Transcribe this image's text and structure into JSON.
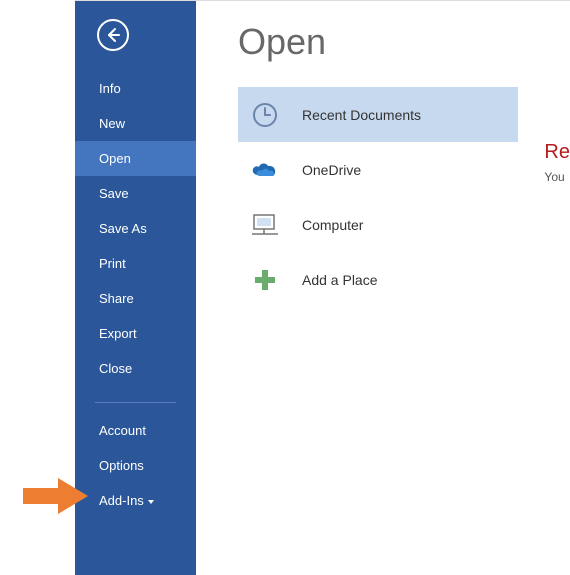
{
  "sidebar": {
    "items": [
      {
        "label": "Info"
      },
      {
        "label": "New"
      },
      {
        "label": "Open"
      },
      {
        "label": "Save"
      },
      {
        "label": "Save As"
      },
      {
        "label": "Print"
      },
      {
        "label": "Share"
      },
      {
        "label": "Export"
      },
      {
        "label": "Close"
      }
    ],
    "footer": [
      {
        "label": "Account"
      },
      {
        "label": "Options"
      },
      {
        "label": "Add-Ins"
      }
    ]
  },
  "main": {
    "title": "Open",
    "sources": [
      {
        "label": "Recent Documents"
      },
      {
        "label": "OneDrive"
      },
      {
        "label": "Computer"
      },
      {
        "label": "Add a Place"
      }
    ],
    "side": {
      "title": "Re",
      "sub": "You"
    }
  }
}
